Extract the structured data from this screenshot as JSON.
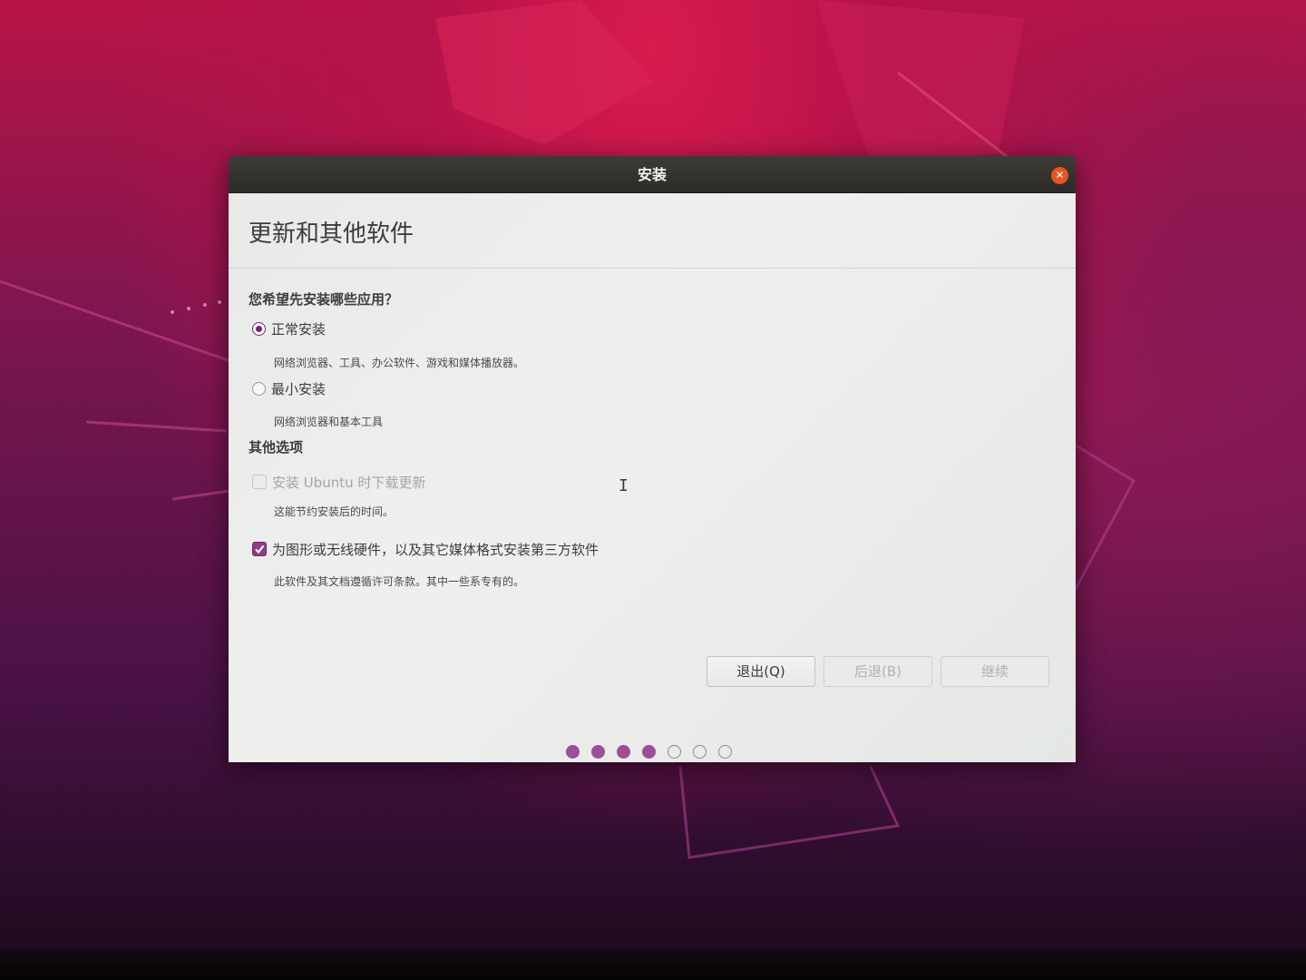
{
  "window": {
    "title": "安装",
    "close_glyph": "✕"
  },
  "page": {
    "title": "更新和其他软件"
  },
  "install_type": {
    "question": "您希望先安装哪些应用？",
    "options": [
      {
        "label": "正常安装",
        "description": "网络浏览器、工具、办公软件、游戏和媒体播放器。",
        "selected": true
      },
      {
        "label": "最小安装",
        "description": "网络浏览器和基本工具",
        "selected": false
      }
    ]
  },
  "other_options": {
    "heading": "其他选项",
    "items": [
      {
        "label": "安装 Ubuntu 时下载更新",
        "description": "这能节约安装后的时间。",
        "checked": false,
        "enabled": false
      },
      {
        "label": "为图形或无线硬件，以及其它媒体格式安装第三方软件",
        "description": "此软件及其文档遵循许可条款。其中一些系专有的。",
        "checked": true,
        "enabled": true
      }
    ]
  },
  "buttons": {
    "quit": "退出(Q)",
    "back": "后退(B)",
    "continue": "继续"
  },
  "progress": {
    "total_steps": 7,
    "completed_steps": 4
  },
  "colors": {
    "accent": "#77216f",
    "close_button": "#e95420",
    "progress_dot": "#9b4f96"
  },
  "icons": {
    "close": "close-icon",
    "checkmark": "checkmark-icon",
    "text_cursor": "i-beam-cursor-icon"
  }
}
